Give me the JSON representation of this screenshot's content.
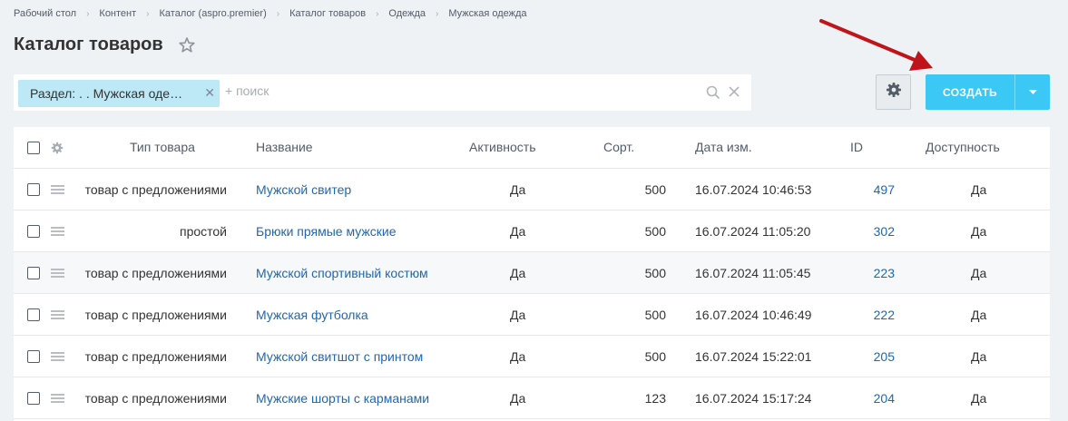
{
  "breadcrumbs": [
    "Рабочий стол",
    "Контент",
    "Каталог (aspro.premier)",
    "Каталог товаров",
    "Одежда",
    "Мужская одежда"
  ],
  "page_title": "Каталог товаров",
  "filter": {
    "chip_label": "Раздел: . . Мужская оде…",
    "search_placeholder": "+ поиск"
  },
  "toolbar": {
    "create_label": "СОЗДАТЬ"
  },
  "table": {
    "headers": {
      "type": "Тип товара",
      "name": "Название",
      "active": "Активность",
      "sort": "Сорт.",
      "date": "Дата изм.",
      "id": "ID",
      "avail": "Доступность"
    },
    "rows": [
      {
        "type": "товар с предложениями",
        "name": "Мужской свитер",
        "active": "Да",
        "sort": "500",
        "date": "16.07.2024 10:46:53",
        "id": "497",
        "avail": "Да"
      },
      {
        "type": "простой",
        "name": "Брюки прямые мужские",
        "active": "Да",
        "sort": "500",
        "date": "16.07.2024 11:05:20",
        "id": "302",
        "avail": "Да"
      },
      {
        "type": "товар с предложениями",
        "name": "Мужской спортивный костюм",
        "active": "Да",
        "sort": "500",
        "date": "16.07.2024 11:05:45",
        "id": "223",
        "avail": "Да"
      },
      {
        "type": "товар с предложениями",
        "name": "Мужская футболка",
        "active": "Да",
        "sort": "500",
        "date": "16.07.2024 10:46:49",
        "id": "222",
        "avail": "Да"
      },
      {
        "type": "товар с предложениями",
        "name": "Мужской свитшот с принтом",
        "active": "Да",
        "sort": "500",
        "date": "16.07.2024 15:22:01",
        "id": "205",
        "avail": "Да"
      },
      {
        "type": "товар с предложениями",
        "name": "Мужские шорты с карманами",
        "active": "Да",
        "sort": "123",
        "date": "16.07.2024 15:17:24",
        "id": "204",
        "avail": "Да"
      }
    ]
  },
  "colors": {
    "accent": "#3bc8f5",
    "chip": "#bde9f6",
    "link": "#2067b0",
    "arrow": "#c0141b",
    "background": "#eef2f4"
  },
  "icons": [
    "star-icon",
    "search-icon",
    "close-icon",
    "gear-icon",
    "chevron-down-icon",
    "drag-handle-icon"
  ]
}
